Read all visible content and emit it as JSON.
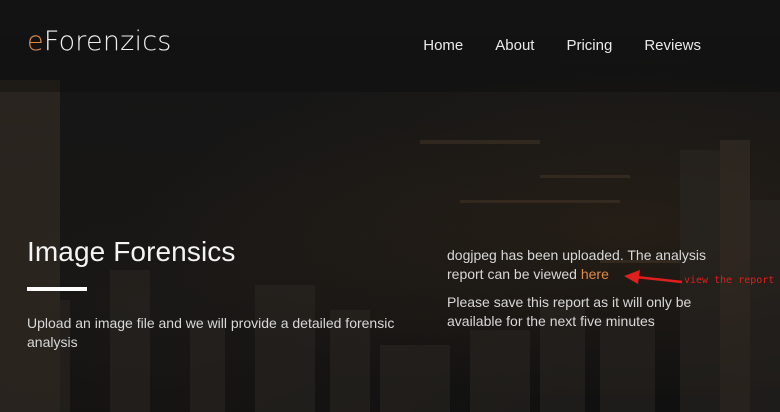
{
  "brand": {
    "accent_letter": "e",
    "rest": "Forenzics"
  },
  "nav": {
    "items": [
      "Home",
      "About",
      "Pricing",
      "Reviews"
    ]
  },
  "hero": {
    "title": "Image Forensics",
    "description": "Upload an image file and we will provide a detailed forensic analysis"
  },
  "status": {
    "uploaded_text": "dogjpeg has been uploaded. The analysis report can be viewed ",
    "link_text": "here",
    "save_notice": "Please save this report as it will only be available for the next five minutes"
  },
  "annotation": {
    "text": "view the report"
  },
  "colors": {
    "accent": "#e08a43",
    "annotation_red": "#e01e1e",
    "background": "#121212"
  },
  "icons": {
    "annotation_arrow": "red-arrow-icon"
  }
}
